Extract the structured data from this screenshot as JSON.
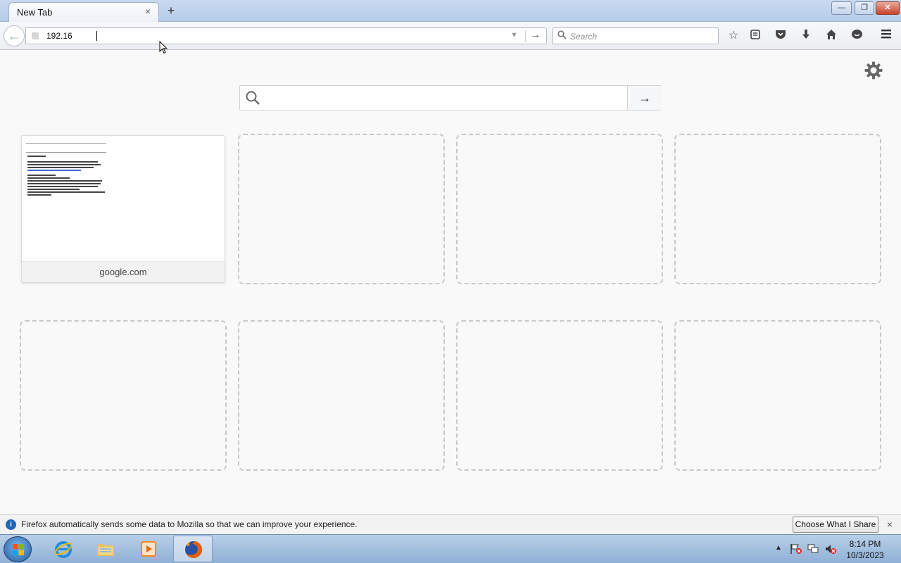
{
  "tab": {
    "title": "New Tab",
    "close": "×",
    "new_tab": "+"
  },
  "window": {
    "minimize": "—",
    "maximize": "❐",
    "close": "✕"
  },
  "navbar": {
    "url_value": "192.16",
    "search_placeholder": "Search",
    "back": "←",
    "go": "→"
  },
  "newtab": {
    "search_go": "→",
    "tiles": [
      {
        "label": "google.com",
        "filled": true
      },
      {
        "label": "",
        "filled": false
      },
      {
        "label": "",
        "filled": false
      },
      {
        "label": "",
        "filled": false
      },
      {
        "label": "",
        "filled": false
      },
      {
        "label": "",
        "filled": false
      },
      {
        "label": "",
        "filled": false
      },
      {
        "label": "",
        "filled": false
      }
    ]
  },
  "notification": {
    "text": "Firefox automatically sends some data to Mozilla so that we can improve your experience.",
    "button": "Choose What I Share",
    "close": "×",
    "icon": "i"
  },
  "taskbar": {
    "time": "8:14 PM",
    "date": "10/3/2023",
    "apps": [
      "internet-explorer",
      "file-explorer",
      "media-player",
      "firefox"
    ]
  }
}
